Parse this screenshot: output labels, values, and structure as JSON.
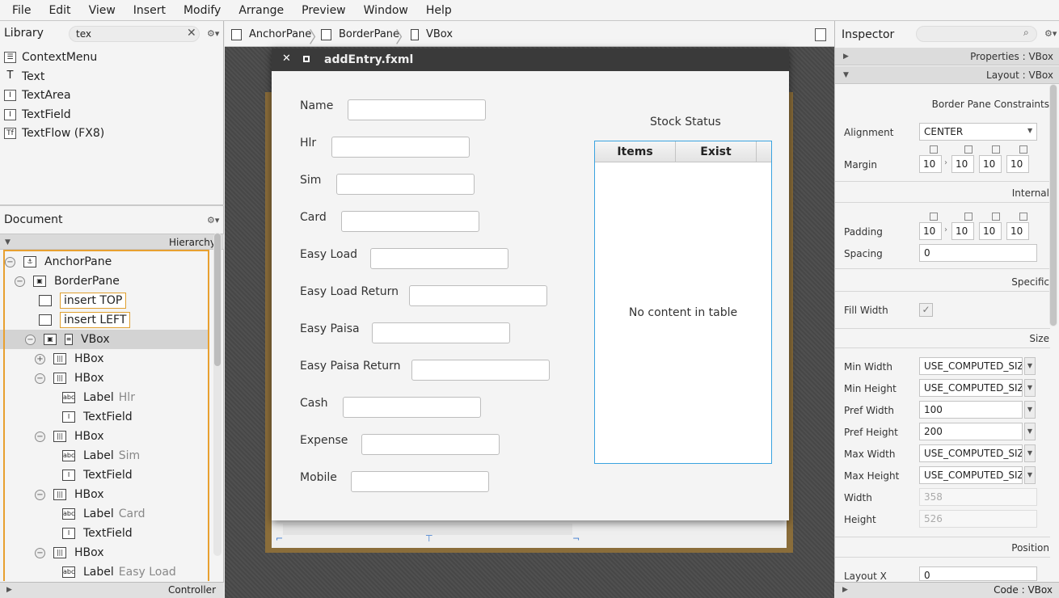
{
  "menubar": {
    "items": [
      "File",
      "Edit",
      "View",
      "Insert",
      "Modify",
      "Arrange",
      "Preview",
      "Window",
      "Help"
    ]
  },
  "library": {
    "title": "Library",
    "search_value": "tex",
    "items": [
      "ContextMenu",
      "Text",
      "TextArea",
      "TextField",
      "TextFlow  (FX8)"
    ]
  },
  "document": {
    "title": "Document",
    "subheader": "Hierarchy",
    "tree": [
      {
        "text": "AnchorPane",
        "sub": ""
      },
      {
        "text": "BorderPane",
        "sub": ""
      },
      {
        "text": "insert TOP",
        "sub": ""
      },
      {
        "text": "insert LEFT",
        "sub": ""
      },
      {
        "text": "VBox",
        "sub": ""
      },
      {
        "text": "HBox",
        "sub": ""
      },
      {
        "text": "HBox",
        "sub": ""
      },
      {
        "text": "Label",
        "sub": "Hlr"
      },
      {
        "text": "TextField",
        "sub": ""
      },
      {
        "text": "HBox",
        "sub": ""
      },
      {
        "text": "Label",
        "sub": "Sim"
      },
      {
        "text": "TextField",
        "sub": ""
      },
      {
        "text": "HBox",
        "sub": ""
      },
      {
        "text": "Label",
        "sub": "Card"
      },
      {
        "text": "TextField",
        "sub": ""
      },
      {
        "text": "HBox",
        "sub": ""
      },
      {
        "text": "Label",
        "sub": "Easy Load"
      }
    ],
    "footer": "Controller"
  },
  "breadcrumb": {
    "items": [
      "AnchorPane",
      "BorderPane",
      "VBox"
    ]
  },
  "window": {
    "title": "addEntry.fxml"
  },
  "form": {
    "labels": [
      "Name",
      "Hlr",
      "Sim",
      "Card",
      "Easy Load",
      "Easy Load Return",
      "Easy Paisa",
      "Easy Paisa Return",
      "Cash",
      "Expense",
      "Mobile"
    ]
  },
  "stock": {
    "title": "Stock Status",
    "col1": "Items",
    "col2": "Exist",
    "empty": "No content in table"
  },
  "inspector": {
    "title": "Inspector",
    "properties": "Properties : VBox",
    "layout": "Layout : VBox",
    "code": "Code : VBox",
    "sections": {
      "bpc": "Border Pane Constraints",
      "internal": "Internal",
      "specific": "Specific",
      "size": "Size",
      "position": "Position"
    },
    "alignment_label": "Alignment",
    "alignment_value": "CENTER",
    "margin_label": "Margin",
    "margin": [
      "10",
      "10",
      "10",
      "10"
    ],
    "padding_label": "Padding",
    "padding": [
      "10",
      "10",
      "10",
      "10"
    ],
    "spacing_label": "Spacing",
    "spacing_value": "0",
    "fillwidth_label": "Fill Width",
    "size_rows": [
      {
        "label": "Min Width",
        "value": "USE_COMPUTED_SIZ"
      },
      {
        "label": "Min Height",
        "value": "USE_COMPUTED_SIZ"
      },
      {
        "label": "Pref Width",
        "value": "100"
      },
      {
        "label": "Pref Height",
        "value": "200"
      },
      {
        "label": "Max Width",
        "value": "USE_COMPUTED_SIZ"
      },
      {
        "label": "Max Height",
        "value": "USE_COMPUTED_SIZ"
      },
      {
        "label": "Width",
        "value": "358"
      },
      {
        "label": "Height",
        "value": "526"
      }
    ],
    "layoutx_label": "Layout X",
    "layoutx_value": "0"
  }
}
